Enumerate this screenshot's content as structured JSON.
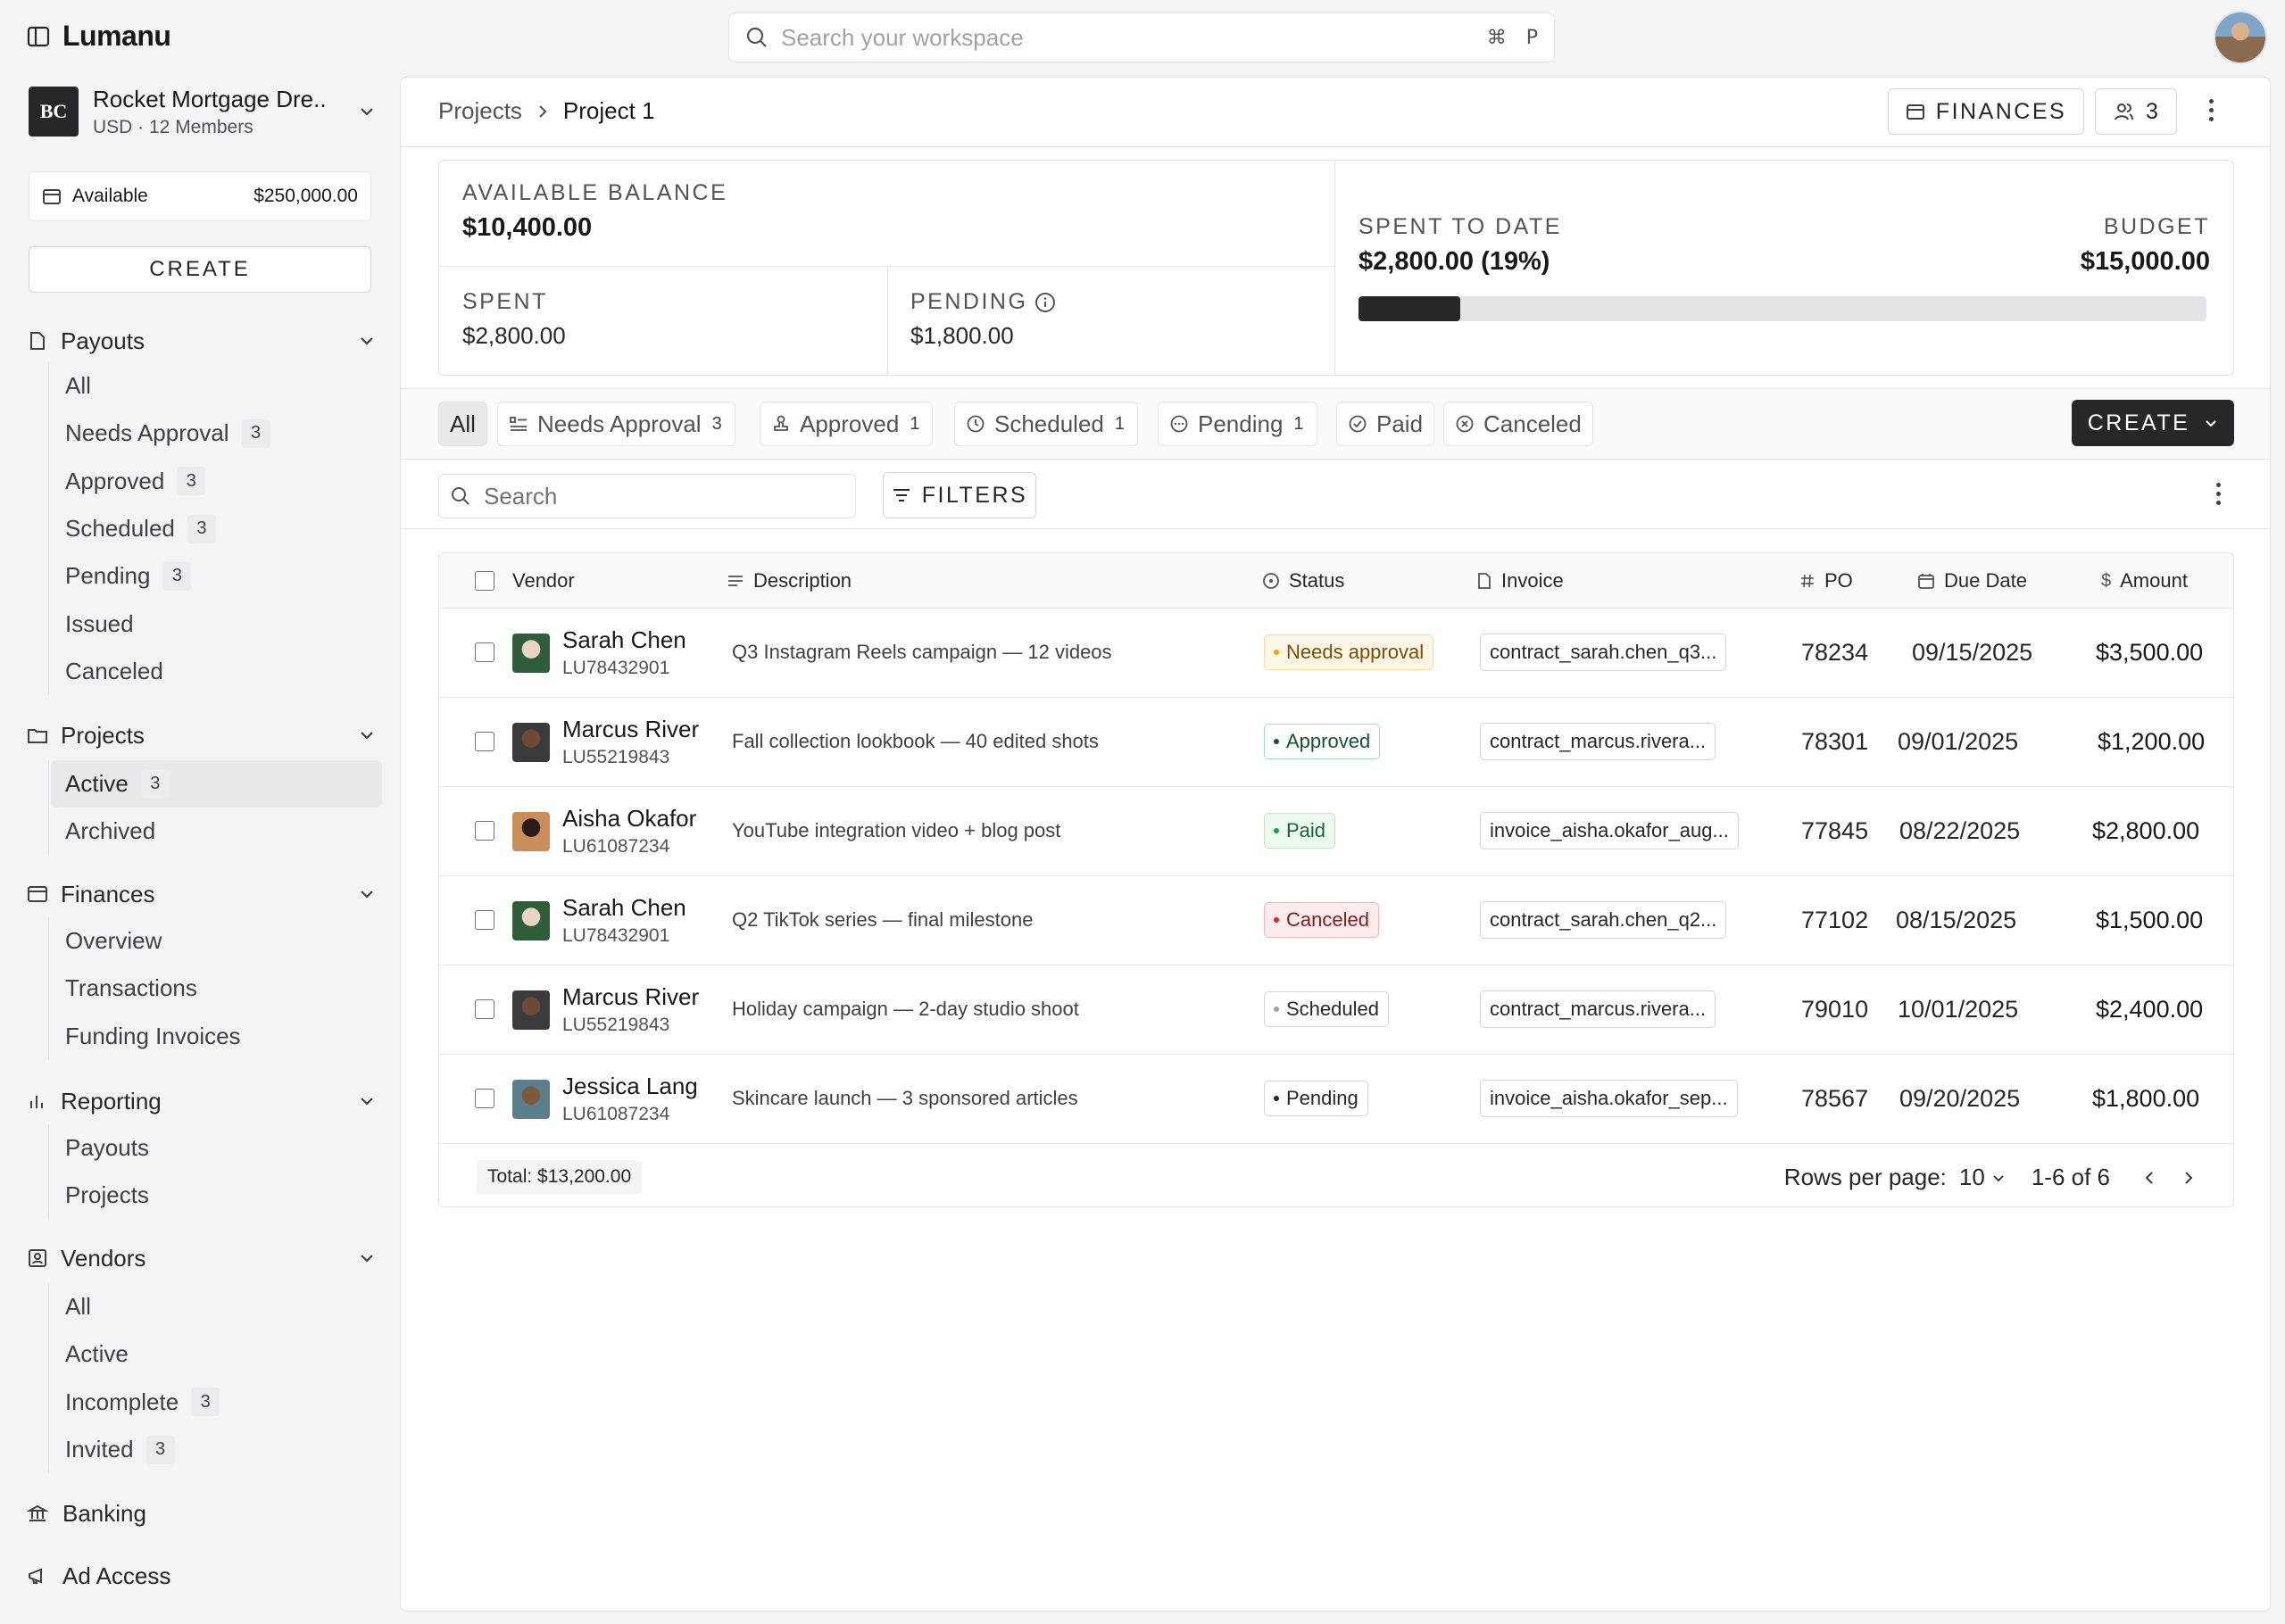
{
  "app": {
    "name": "Lumanu"
  },
  "search": {
    "placeholder": "Search your workspace",
    "shortcut_mod": "⌘",
    "shortcut_key": "P"
  },
  "org": {
    "initials": "BC",
    "name": "Rocket Mortgage Dre..",
    "sub": "USD · 12 Members"
  },
  "available": {
    "label": "Available",
    "amount": "$250,000.00"
  },
  "sidebar": {
    "create_label": "CREATE",
    "sections": [
      {
        "title": "Payouts",
        "items": [
          {
            "label": "All",
            "badge": ""
          },
          {
            "label": "Needs Approval",
            "badge": "3"
          },
          {
            "label": "Approved",
            "badge": "3"
          },
          {
            "label": "Scheduled",
            "badge": "3"
          },
          {
            "label": "Pending",
            "badge": "3"
          },
          {
            "label": "Issued",
            "badge": ""
          },
          {
            "label": "Canceled",
            "badge": ""
          }
        ]
      },
      {
        "title": "Projects",
        "items": [
          {
            "label": "Active",
            "badge": "3"
          },
          {
            "label": "Archived",
            "badge": ""
          }
        ]
      },
      {
        "title": "Finances",
        "items": [
          {
            "label": "Overview"
          },
          {
            "label": "Transactions"
          },
          {
            "label": "Funding Invoices"
          }
        ]
      },
      {
        "title": "Reporting",
        "items": [
          {
            "label": "Payouts"
          },
          {
            "label": "Projects"
          }
        ]
      },
      {
        "title": "Vendors",
        "items": [
          {
            "label": "All",
            "badge": ""
          },
          {
            "label": "Active",
            "badge": ""
          },
          {
            "label": "Incomplete",
            "badge": "3"
          },
          {
            "label": "Invited",
            "badge": "3"
          }
        ]
      }
    ],
    "banking": "Banking",
    "ad_access": "Ad Access"
  },
  "header": {
    "breadcrumb": [
      "Projects",
      "Project 1"
    ],
    "finances_label": "FINANCES",
    "members_count": "3"
  },
  "summary": {
    "available_balance_label": "AVAILABLE BALANCE",
    "available_balance": "$10,400.00",
    "spent_label": "SPENT",
    "spent": "$2,800.00",
    "pending_label": "PENDING",
    "pending": "$1,800.00",
    "spent_to_date_label": "SPENT TO DATE",
    "spent_to_date": "$2,800.00 (19%)",
    "budget_label": "BUDGET",
    "budget": "$15,000.00",
    "progress_pct": 12
  },
  "tabs": [
    {
      "label": "All",
      "badge": ""
    },
    {
      "label": "Needs Approval",
      "badge": "3"
    },
    {
      "label": "Approved",
      "badge": "1"
    },
    {
      "label": "Scheduled",
      "badge": "1"
    },
    {
      "label": "Pending",
      "badge": "1"
    },
    {
      "label": "Paid",
      "badge": ""
    },
    {
      "label": "Canceled",
      "badge": ""
    }
  ],
  "create_label": "CREATE",
  "filter": {
    "search_placeholder": "Search",
    "filters_label": "FILTERS"
  },
  "table": {
    "columns": [
      "Vendor",
      "Description",
      "Status",
      "Invoice",
      "PO",
      "Due Date",
      "Amount"
    ],
    "rows": [
      {
        "name": "Sarah Chen",
        "id": "LU78432901",
        "desc": "Q3 Instagram Reels campaign — 12 videos",
        "status": "Needs approval",
        "invoice": "contract_sarah.chen_q3...",
        "po": "78234",
        "due": "09/15/2025",
        "amount": "$3,500.00"
      },
      {
        "name": "Marcus River",
        "id": "LU55219843",
        "desc": "Fall collection lookbook — 40 edited shots",
        "status": "Approved",
        "invoice": "contract_marcus.rivera...",
        "po": "78301",
        "due": "09/01/2025",
        "amount": "$1,200.00"
      },
      {
        "name": "Aisha Okafor",
        "id": "LU61087234",
        "desc": "YouTube integration video + blog post",
        "status": "Paid",
        "invoice": "invoice_aisha.okafor_aug...",
        "po": "77845",
        "due": "08/22/2025",
        "amount": "$2,800.00"
      },
      {
        "name": "Sarah Chen",
        "id": "LU78432901",
        "desc": "Q2 TikTok series — final milestone",
        "status": "Canceled",
        "invoice": "contract_sarah.chen_q2...",
        "po": "77102",
        "due": "08/15/2025",
        "amount": "$1,500.00"
      },
      {
        "name": "Marcus River",
        "id": "LU55219843",
        "desc": "Holiday campaign — 2-day studio shoot",
        "status": "Scheduled",
        "invoice": "contract_marcus.rivera...",
        "po": "79010",
        "due": "10/01/2025",
        "amount": "$2,400.00"
      },
      {
        "name": "Jessica Lang",
        "id": "LU61087234",
        "desc": "Skincare launch — 3 sponsored articles",
        "status": "Pending",
        "invoice": "invoice_aisha.okafor_sep...",
        "po": "78567",
        "due": "09/20/2025",
        "amount": "$1,800.00"
      }
    ],
    "total": "Total: $13,200.00",
    "rows_per_page_label": "Rows per page:",
    "rows_per_page": "10",
    "range": "1-6 of 6"
  },
  "status_colors": {
    "Needs approval": {
      "bg": "#fff7e6",
      "border": "#fcd9a0",
      "text": "#7a4b06",
      "dot": "#f59e0b"
    },
    "Approved": {
      "bg": "#ffffff",
      "border": "#a7d9c7",
      "text": "#14532d",
      "dot": "#0f5132"
    },
    "Paid": {
      "bg": "#eefaf0",
      "border": "#bfe6c7",
      "text": "#166534",
      "dot": "#16a34a"
    },
    "Canceled": {
      "bg": "#fdecec",
      "border": "#f5b5b5",
      "text": "#7f1d1d",
      "dot": "#dc2626"
    },
    "Scheduled": {
      "bg": "#ffffff",
      "border": "#d4d4d8",
      "text": "#27272a",
      "dot": "#a1a1aa"
    },
    "Pending": {
      "bg": "#ffffff",
      "border": "#d4d4d8",
      "text": "#27272a",
      "dot": "#27272a"
    }
  }
}
